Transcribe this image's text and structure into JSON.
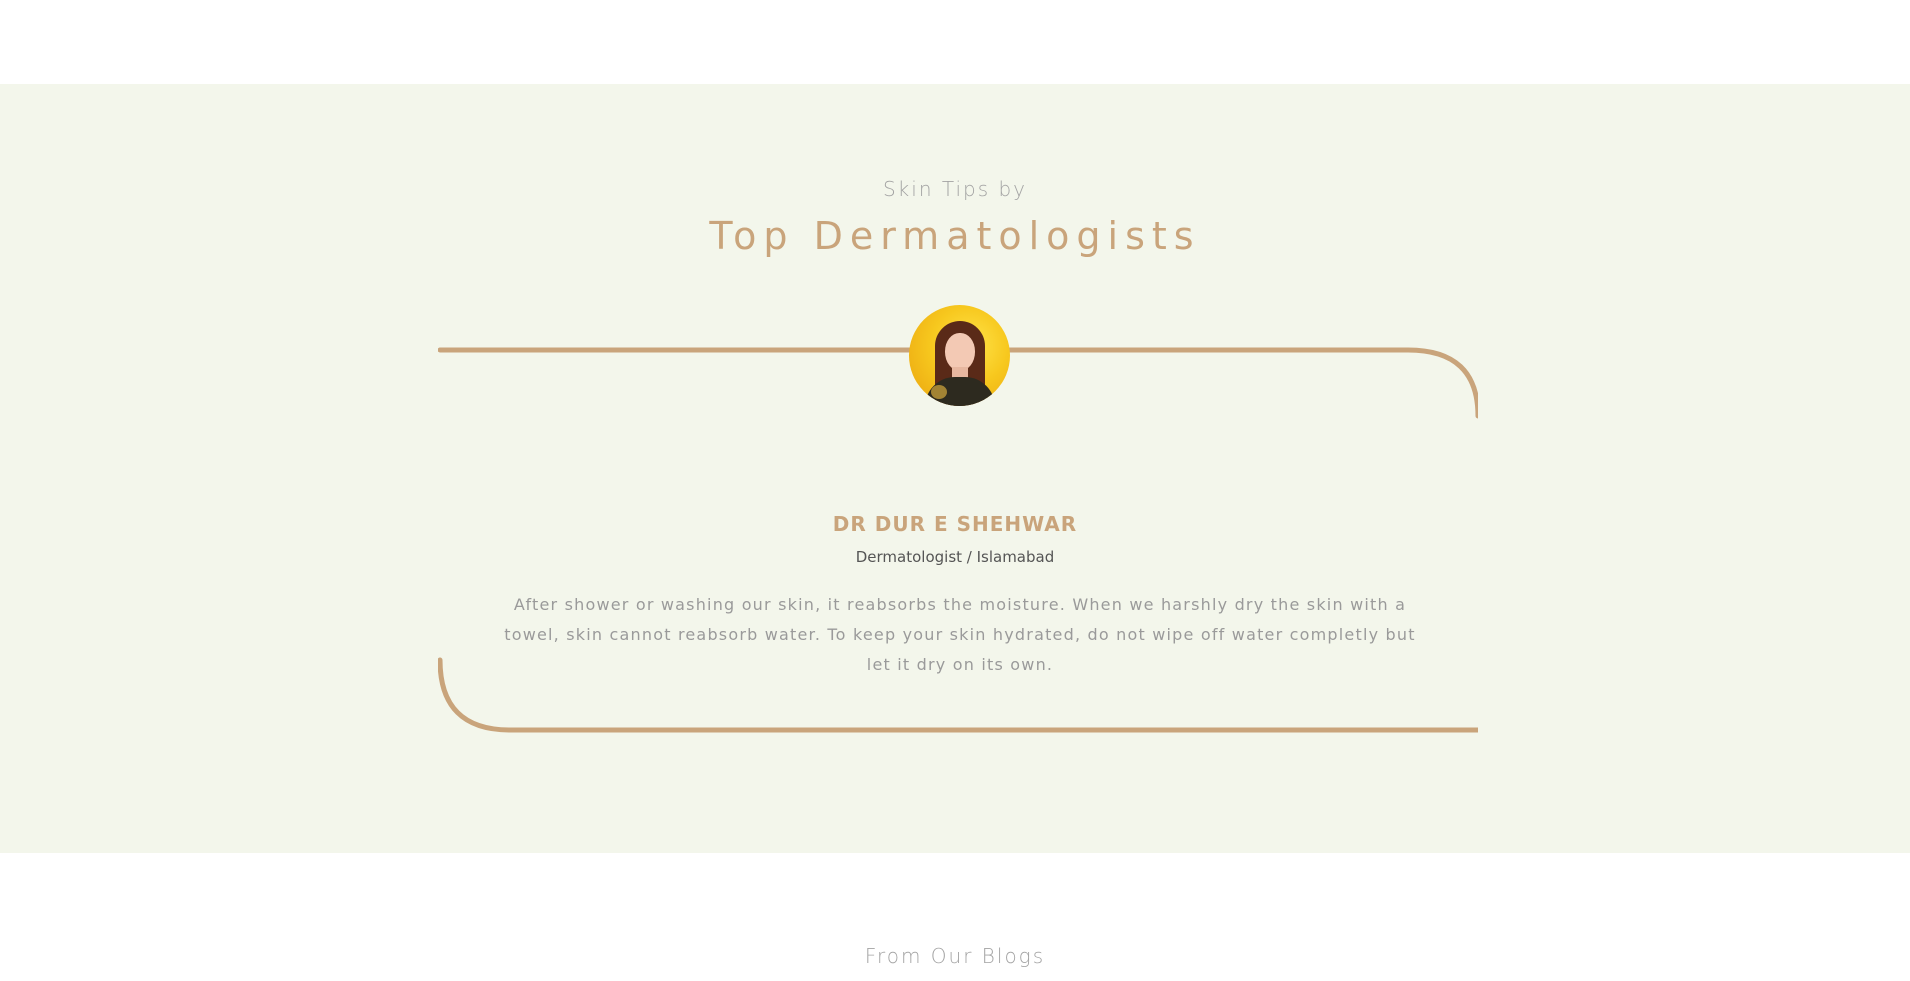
{
  "tips_section": {
    "subtitle": "Skin Tips by",
    "title": "Top Dermatologists",
    "card": {
      "doctor_name": "DR DUR E SHEHWAR",
      "doctor_role": "Dermatologist / Islamabad",
      "tip": "After shower or washing our skin, it reabsorbs the moisture. When we harshly dry the skin with a towel, skin cannot reabsorb water. To keep your skin hydrated, do not wipe off water completly but let it dry on its own."
    }
  },
  "blogs_section": {
    "heading": "From Our Blogs"
  },
  "colors": {
    "section_background": "#f3f6eb",
    "accent_gold": "#c9a47b",
    "muted_text": "#a3a3a3"
  }
}
